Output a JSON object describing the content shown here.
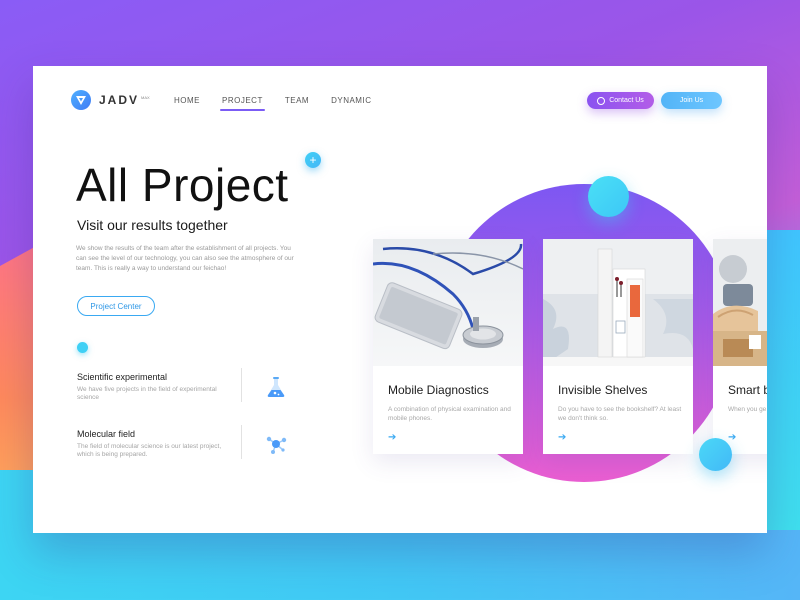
{
  "header": {
    "logo_text": "JADV",
    "logo_sup": "MAX",
    "nav": [
      "HOME",
      "PROJECT",
      "TEAM",
      "DYNAMIC"
    ],
    "active_nav": "PROJECT",
    "contact_label": "Contact Us",
    "join_label": "Join Us"
  },
  "hero": {
    "title": "All Project",
    "subtitle": "Visit our results together",
    "description": "We show the results of the team after the establishment of all projects. You can see the level of our technology, you can also see the atmosphere of our team. This is really a way to understand our feichao!",
    "cta_label": "Project Center"
  },
  "features": [
    {
      "title": "Scientific experimental",
      "description": "We have five projects in the field of experimental science",
      "icon": "flask-icon"
    },
    {
      "title": "Molecular field",
      "description": "The field of molecular science is our latest project, which is being prepared.",
      "icon": "molecule-icon"
    }
  ],
  "cards": [
    {
      "title": "Mobile Diagnostics",
      "description": "A combination of physical examination and mobile phones.",
      "image": "stethoscope-phone"
    },
    {
      "title": "Invisible Shelves",
      "description": "Do you have to see the bookshelf? At least we don't think so.",
      "image": "books-on-shelf"
    },
    {
      "title": "Smart b",
      "description": "When you ge breakfast bef",
      "image": "breakfast-toaster"
    }
  ],
  "colors": {
    "accent_purple": "#8a53f0",
    "accent_blue": "#3aa9f2",
    "cyan": "#3fd0f5",
    "pink": "#ea5ed1"
  }
}
